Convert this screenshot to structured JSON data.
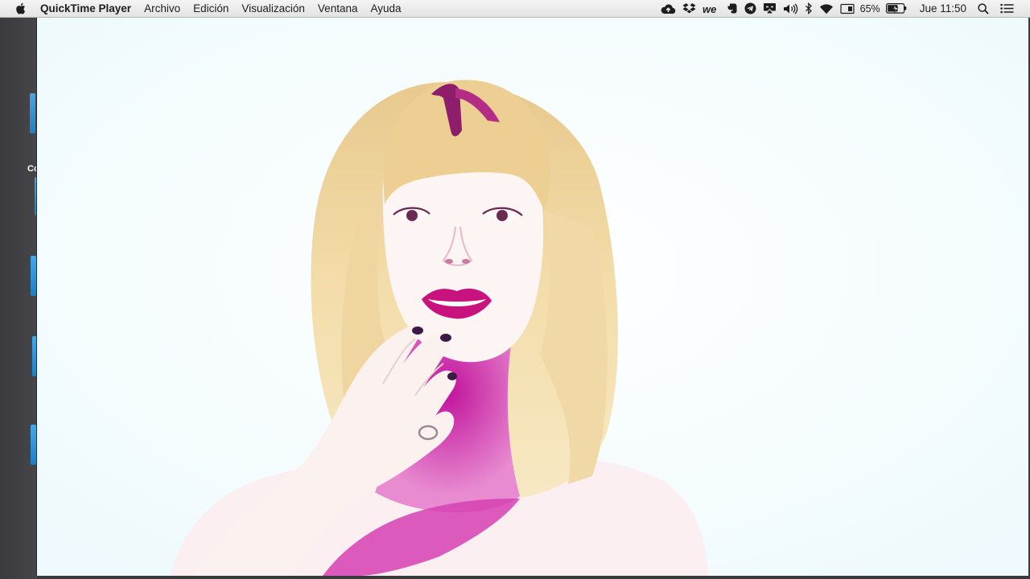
{
  "menubar": {
    "apple_icon": "apple-logo-icon",
    "app_name": "QuickTime Player",
    "menus": [
      "Archivo",
      "Edición",
      "Visualización",
      "Ventana",
      "Ayuda"
    ],
    "status": {
      "icons": [
        "cloud-upload-icon",
        "dropbox-icon",
        "wetransfer-icon",
        "evernote-icon",
        "telegram-icon",
        "airplay-icon",
        "volume-icon",
        "bluetooth-icon",
        "wifi-icon",
        "calendar-icon"
      ],
      "battery_percent": "65%",
      "battery_level": 0.65,
      "clock": "Jue 11:50",
      "search_icon": "spotlight-search-icon",
      "notification_icon": "notification-center-icon"
    }
  },
  "desktop": {
    "label_fragment": "Cc"
  },
  "player": {
    "content": "video-frame",
    "colors": {
      "background": "#f1fcfe",
      "hair": "#f1d9a3",
      "magenta": "#c20f9a",
      "skin": "#fbeff0"
    }
  }
}
